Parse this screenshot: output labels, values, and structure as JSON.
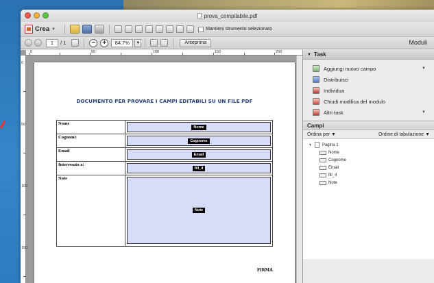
{
  "window": {
    "title": "prova_compilabile.pdf"
  },
  "toolbar": {
    "create_label": "Crea",
    "keep_tool_label": "Mantieni strumento selezionato"
  },
  "nav": {
    "current_page": "1",
    "total_pages": "/ 1",
    "zoom": "84,7%",
    "preview_label": "Anteprima",
    "forms_label": "Moduli"
  },
  "ruler": {
    "h_marks": [
      "0",
      "50",
      "100",
      "150",
      "200"
    ],
    "v_marks": [
      "0",
      "50",
      "100",
      "150"
    ]
  },
  "document": {
    "title": "DOCUMENTO PER PROVARE I CAMPI EDITABILI SU UN FILE PDF",
    "rows": [
      {
        "label": "Nome",
        "field": "Nome"
      },
      {
        "label": "Cognome",
        "field": "Cognome"
      },
      {
        "label": "Email",
        "field": "Email"
      },
      {
        "label": "Interessato a:",
        "field": "fill_4"
      },
      {
        "label": "Note",
        "field": "Note"
      }
    ],
    "signature": "FIRMA"
  },
  "panel": {
    "task_header": "Task",
    "tasks": [
      {
        "label": "Aggiungi nuovo campo",
        "icon": "add-field-icon"
      },
      {
        "label": "Distribuisci",
        "icon": "distribute-icon"
      },
      {
        "label": "Individua",
        "icon": "find-icon"
      },
      {
        "label": "Chiudi modifica del modulo",
        "icon": "close-edit-icon"
      },
      {
        "label": "Altri task",
        "icon": "more-tasks-icon"
      }
    ],
    "fields_header": "Campi",
    "sort_by": "Ordina per",
    "tab_order": "Ordine di tabulazione",
    "tree_root": "Pagina 1",
    "tree_items": [
      "Nome",
      "Cognome",
      "Email",
      "fill_4",
      "Note"
    ]
  }
}
